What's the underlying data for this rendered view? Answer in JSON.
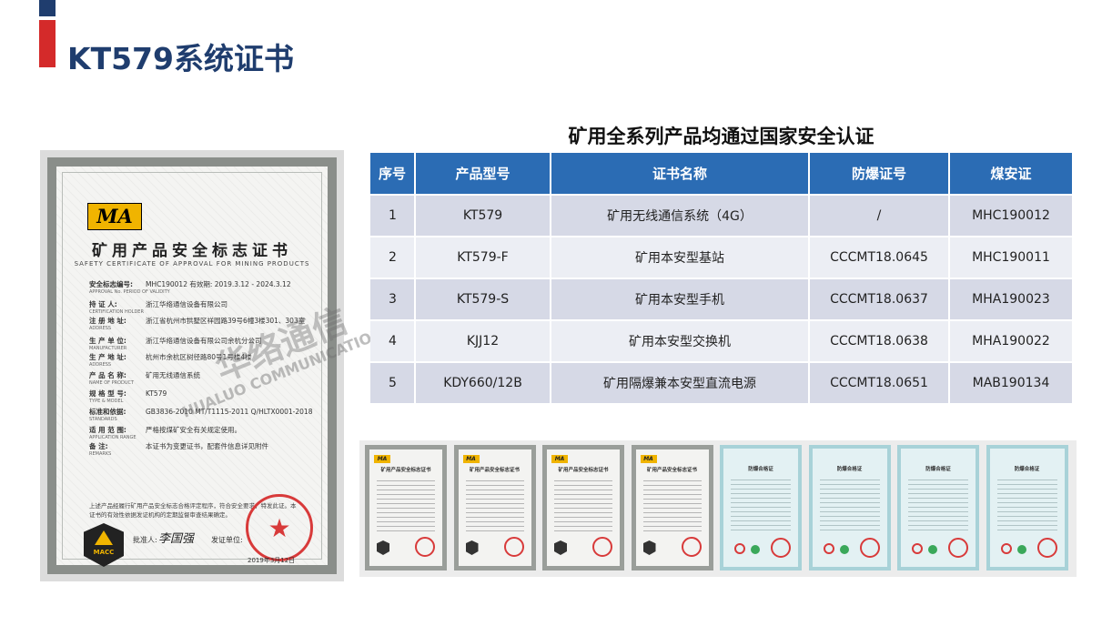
{
  "header": {
    "title": "KT579系统证书"
  },
  "certificate": {
    "logo": "MA",
    "title": "矿用产品安全标志证书",
    "subtitle": "SAFETY CERTIFICATE OF APPROVAL FOR MINING PRODUCTS",
    "lines": [
      {
        "label": "安全标志编号:",
        "value": "MHC190012        有效期: 2019.3.12 - 2024.3.12",
        "sub": "APPROVAL No.                PERIOD OF VALIDITY"
      },
      {
        "label": "持 证 人:",
        "value": "浙江华络通信设备有限公司",
        "sub": "CERTIFICATION HOLDER"
      },
      {
        "label": "注 册 地 址:",
        "value": "浙江省杭州市拱墅区祥园路39号6幢3楼301、303室",
        "sub": "ADDRESS"
      },
      {
        "label": "生 产 单 位:",
        "value": "浙江华络通信设备有限公司余杭分公司",
        "sub": "MANUFACTURER"
      },
      {
        "label": "生 产 地 址:",
        "value": "杭州市余杭区树径路80号1号楼4楼",
        "sub": "ADDRESS"
      },
      {
        "label": "产 品 名 称:",
        "value": "矿用无线通信系统",
        "sub": "NAME OF PRODUCT"
      },
      {
        "label": "规 格 型 号:",
        "value": "KT579",
        "sub": "TYPE & MODEL"
      },
      {
        "label": "标准和依据:",
        "value": "GB3836-2010 MT/T1115-2011 Q/HLTX0001-2018",
        "sub": "STANDARDS"
      },
      {
        "label": "适 用 范 围:",
        "value": "严格按煤矿安全有关规定使用。",
        "sub": "APPLICATION RANGE"
      },
      {
        "label": "备     注:",
        "value": "本证书为变更证书，配套件信息详见附件",
        "sub": "REMARKS"
      }
    ],
    "remark": "上述产品经履行矿用产品安全标志合格评定程序，符合安全要求，特发此证。本证书的有效性依据发证机构的定期监督审查结果确定。",
    "watermark_cn": "华络通信",
    "watermark_en": "HUALUO COMMUNICATIONS",
    "badge_text": "MACC",
    "issuer_label": "发证单位:",
    "approver_label": "批准人:",
    "signature": "李国强",
    "date": "2019年3月12日"
  },
  "table": {
    "heading": "矿用全系列产品均通过国家安全认证",
    "columns": [
      "序号",
      "产品型号",
      "证书名称",
      "防爆证号",
      "煤安证"
    ],
    "rows": [
      [
        "1",
        "KT579",
        "矿用无线通信系统（4G）",
        "/",
        "MHC190012"
      ],
      [
        "2",
        "KT579-F",
        "矿用本安型基站",
        "CCCMT18.0645",
        "MHC190011"
      ],
      [
        "3",
        "KT579-S",
        "矿用本安型手机",
        "CCCMT18.0637",
        "MHA190023"
      ],
      [
        "4",
        "KJJ12",
        "矿用本安型交换机",
        "CCCMT18.0638",
        "MHA190022"
      ],
      [
        "5",
        "KDY660/12B",
        "矿用隔爆兼本安型直流电源",
        "CCCMT18.0651",
        "MAB190134"
      ]
    ]
  },
  "thumbnails": [
    {
      "type": "safety",
      "logo": "MA",
      "title": "矿用产品安全标志证书"
    },
    {
      "type": "safety",
      "logo": "MA",
      "title": "矿用产品安全标志证书"
    },
    {
      "type": "safety",
      "logo": "MA",
      "title": "矿用产品安全标志证书"
    },
    {
      "type": "safety",
      "logo": "MA",
      "title": "矿用产品安全标志证书"
    },
    {
      "type": "explosion",
      "logo": "",
      "title": "防爆合格证"
    },
    {
      "type": "explosion",
      "logo": "",
      "title": "防爆合格证"
    },
    {
      "type": "explosion",
      "logo": "",
      "title": "防爆合格证"
    },
    {
      "type": "explosion",
      "logo": "",
      "title": "防爆合格证"
    }
  ]
}
